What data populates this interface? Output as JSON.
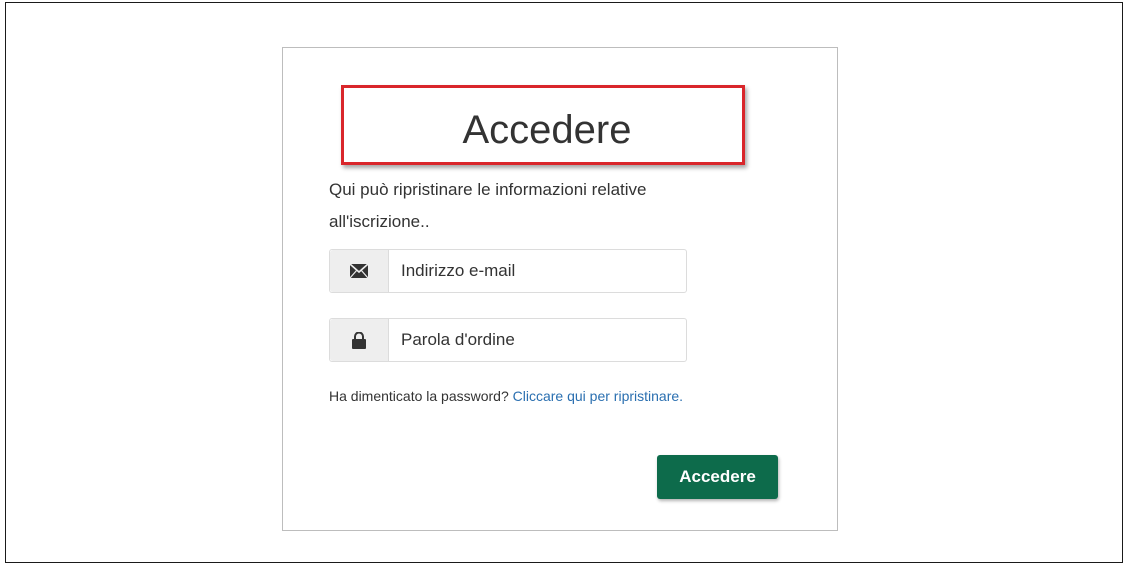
{
  "login": {
    "title": "Accedere",
    "intro": "Qui può ripristinare le informazioni relative all'iscrizione..",
    "email": {
      "placeholder": "Indirizzo e-mail",
      "value": "",
      "icon": "envelope-icon"
    },
    "password": {
      "placeholder": "Parola d'ordine",
      "value": "",
      "icon": "lock-icon"
    },
    "forgot_text": "Ha dimenticato la password?",
    "forgot_link": "Cliccare qui per ripristinare.",
    "submit_label": "Accedere"
  },
  "colors": {
    "accent": "#0d6b4b",
    "highlight": "#d9262b",
    "link": "#2a6fb0"
  }
}
